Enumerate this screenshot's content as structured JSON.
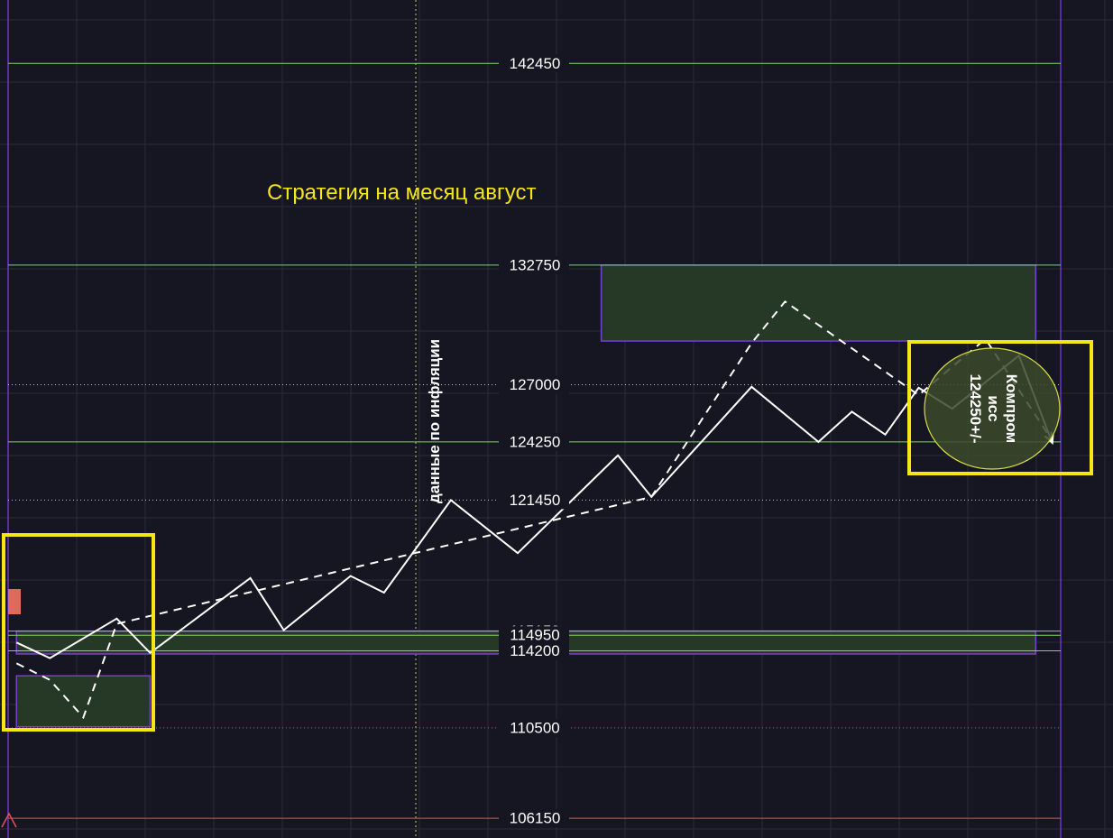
{
  "chart_data": {
    "type": "line",
    "title": "Стратегия на месяц август",
    "vertical_annotation": "данные по инфляции",
    "target_annotation": [
      "Компром",
      "исс",
      "124250+/-"
    ],
    "levels": [
      {
        "value": 142450,
        "label": "142450",
        "color": "#7ed957",
        "style": "solid"
      },
      {
        "value": 132750,
        "label": "132750",
        "color": "#7ed957",
        "style": "solid"
      },
      {
        "value": 127000,
        "label": "127000",
        "color": "#c8c8c8",
        "style": "dotted"
      },
      {
        "value": 124250,
        "label": "124250",
        "color": "#7ed957",
        "style": "solid"
      },
      {
        "value": 121450,
        "label": "121450",
        "color": "#c8c8c8",
        "style": "dotted"
      },
      {
        "value": 115150,
        "label": "115150",
        "color": "#7ed957",
        "style": "solid"
      },
      {
        "value": 114950,
        "label": "114950",
        "color": "#7ed957",
        "style": "solid"
      },
      {
        "value": 114200,
        "label": "114200",
        "color": "#7ed957",
        "style": "solid"
      },
      {
        "value": 110500,
        "label": "110500",
        "color": "#e05555",
        "style": "dotted"
      },
      {
        "value": 106150,
        "label": "106150",
        "color": "#e05555",
        "style": "solid"
      }
    ],
    "zones": [
      {
        "name": "upper-supply-zone",
        "t_start": 35,
        "t_end": 61,
        "v_top": 132750,
        "v_bottom": 129100
      },
      {
        "name": "mid-band-zone",
        "t_start": 0,
        "t_end": 61,
        "v_top": 115150,
        "v_bottom": 114050
      },
      {
        "name": "lower-left-zone",
        "t_start": 0,
        "t_end": 8,
        "v_top": 113000,
        "v_bottom": 110550
      }
    ],
    "series": [
      {
        "style": "solid",
        "points": [
          [
            0,
            114600
          ],
          [
            2,
            113850
          ],
          [
            6,
            115750
          ],
          [
            8,
            114100
          ],
          [
            14,
            117700
          ],
          [
            16,
            115200
          ],
          [
            20,
            117800
          ],
          [
            22,
            117000
          ],
          [
            26,
            121450
          ],
          [
            30,
            118900
          ],
          [
            36,
            123600
          ],
          [
            38,
            121600
          ],
          [
            44,
            126900
          ],
          [
            48,
            124250
          ],
          [
            50,
            125700
          ],
          [
            52,
            124600
          ],
          [
            54,
            126850
          ],
          [
            56,
            125850
          ],
          [
            60,
            128400
          ],
          [
            62,
            124200
          ]
        ]
      },
      {
        "style": "dashed",
        "points": [
          [
            0,
            113600
          ],
          [
            2,
            112800
          ],
          [
            4,
            111000
          ],
          [
            6,
            115500
          ],
          [
            38,
            121600
          ],
          [
            44,
            129000
          ],
          [
            46,
            131000
          ],
          [
            54,
            126500
          ],
          [
            58,
            129200
          ],
          [
            62,
            124300
          ]
        ]
      }
    ],
    "ylim": [
      105200,
      145500
    ],
    "xlim": [
      -0.5,
      62.5
    ],
    "colors": {
      "background": "#161622",
      "grid": "#2a2a3a",
      "price_line": "#ffffff",
      "zone_fill": "#263926",
      "zone_border": "#7a3fd0",
      "highlight_box": "#f5e614",
      "target_circle_fill": "#3b4a2a",
      "target_circle_stroke": "#d4e040"
    }
  }
}
